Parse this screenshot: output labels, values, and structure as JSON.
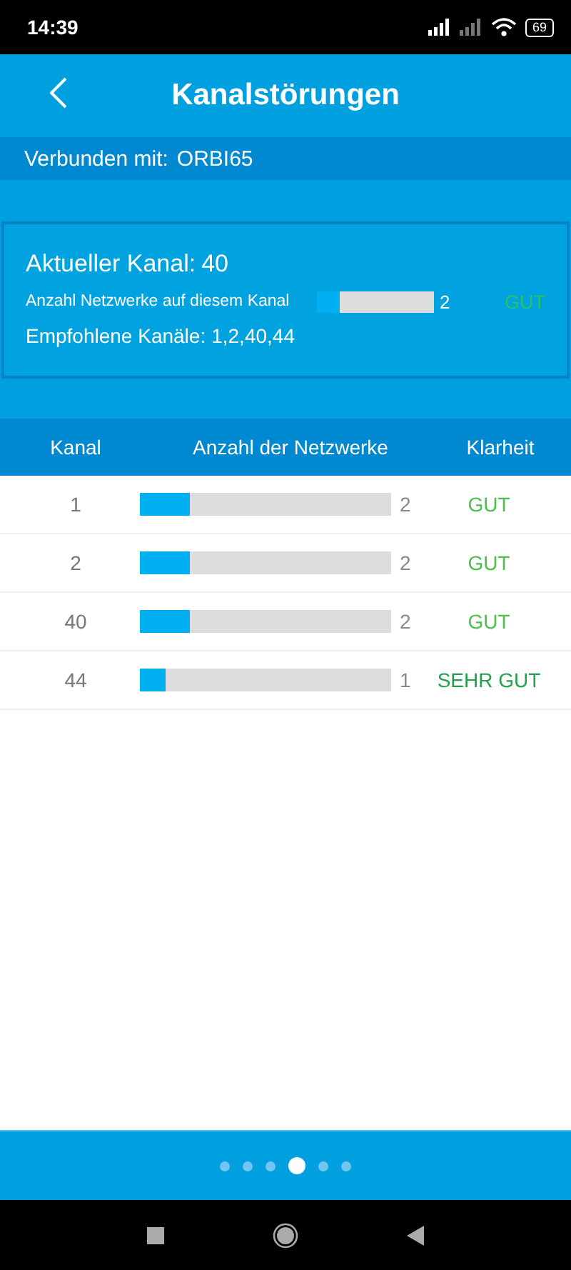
{
  "status_bar": {
    "time": "14:39",
    "battery": "69"
  },
  "header": {
    "title": "Kanalstörungen"
  },
  "connection": {
    "label": "Verbunden mit:",
    "network": "ORBI65"
  },
  "current": {
    "channel_label": "Aktueller Kanal:",
    "channel": "40",
    "networks_label": "Anzahl Netzwerke auf diesem Kanal",
    "level": 0.2,
    "count": "2",
    "clarity": "GUT",
    "recommended_label": "Empfohlene Kanäle:",
    "recommended": "1,2,40,44"
  },
  "table": {
    "columns": [
      "Kanal",
      "Anzahl der Netzwerke",
      "Klarheit"
    ],
    "rows": [
      {
        "channel": "1",
        "level": 0.2,
        "count": "2",
        "clarity": "GUT",
        "color": "#4cbf4c"
      },
      {
        "channel": "2",
        "level": 0.2,
        "count": "2",
        "clarity": "GUT",
        "color": "#4cbf4c"
      },
      {
        "channel": "40",
        "level": 0.2,
        "count": "2",
        "clarity": "GUT",
        "color": "#4cbf4c"
      },
      {
        "channel": "44",
        "level": 0.1,
        "count": "1",
        "clarity": "SEHR GUT",
        "color": "#22a04e"
      }
    ]
  },
  "pager": [
    {
      "selected": false
    },
    {
      "selected": false
    },
    {
      "selected": false
    },
    {
      "selected": true
    },
    {
      "selected": false
    },
    {
      "selected": false
    }
  ]
}
